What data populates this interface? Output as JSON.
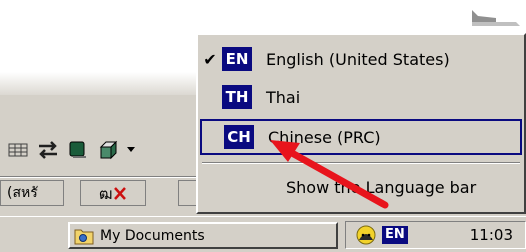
{
  "language_menu": {
    "items": [
      {
        "code": "EN",
        "label": "English (United States)",
        "checked": true
      },
      {
        "code": "TH",
        "label": "Thai",
        "checked": false
      },
      {
        "code": "CH",
        "label": "Chinese (PRC)",
        "checked": false
      }
    ],
    "show_language_bar": "Show the Language bar",
    "check_mark": "✔"
  },
  "background": {
    "field_left_text": "(สหรั",
    "field_icon_text": "ฒ"
  },
  "taskbar": {
    "task_button_label": "My Documents",
    "language_indicator": "EN",
    "clock": "11:03"
  },
  "colors": {
    "lang_badge": "#0a0a80",
    "arrow": "#e8141c",
    "face": "#d4d0c8"
  }
}
